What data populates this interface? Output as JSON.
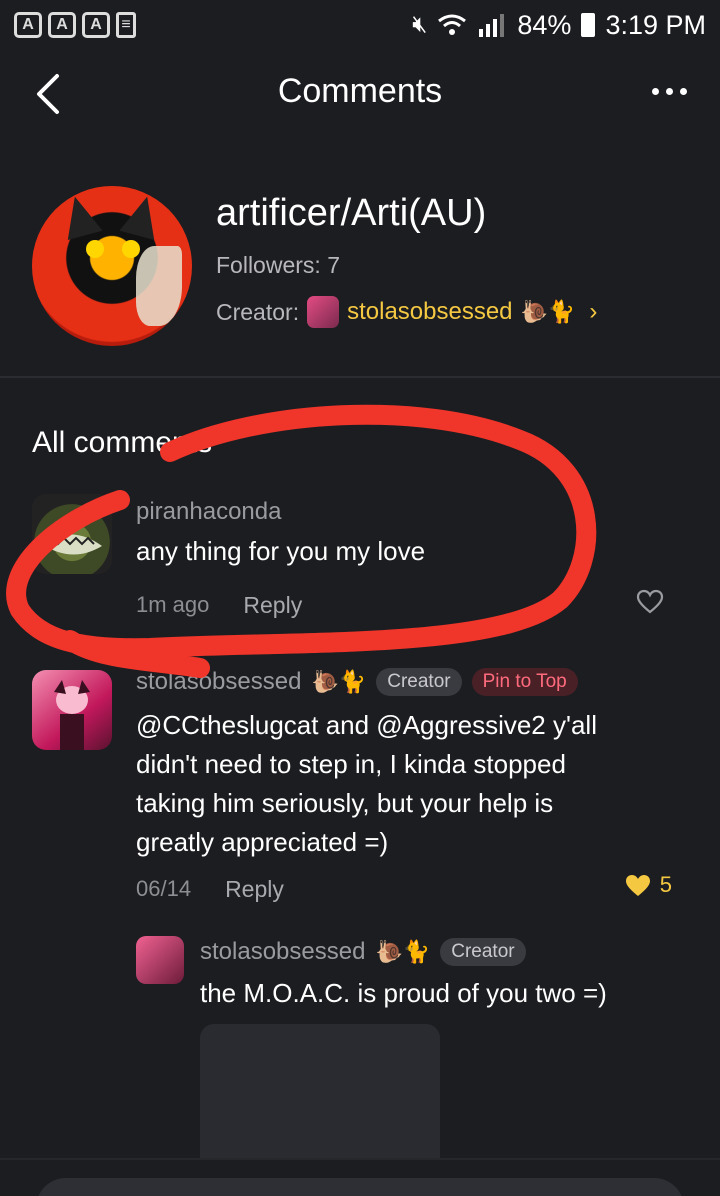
{
  "status_bar": {
    "time": "3:19 PM",
    "battery": "84%",
    "app_icons": [
      "A",
      "A",
      "A"
    ]
  },
  "header": {
    "title": "Comments"
  },
  "profile": {
    "name": "artificer/Arti(AU)",
    "followers": "Followers: 7",
    "creator_label": "Creator:",
    "creator_name": "stolasobsessed",
    "creator_emoji": "🐌🐈"
  },
  "section_title": "All comments",
  "comments": [
    {
      "user": "piranhaconda",
      "text": "any thing for you my love",
      "time": "1m ago",
      "reply": "Reply"
    },
    {
      "user": "stolasobsessed",
      "emoji": "🐌🐈",
      "badge": "Creator",
      "pin": "Pin to Top",
      "text": "@CCtheslugcat and @Aggressive2 y'all didn't need to step in, I kinda stopped taking him seriously, but your help is greatly appreciated =)",
      "time": "06/14",
      "reply": "Reply",
      "likes": "5"
    }
  ],
  "nested_reply": {
    "user": "stolasobsessed",
    "emoji": "🐌🐈",
    "badge": "Creator",
    "text": "the M.O.A.C. is proud of you two =)"
  },
  "colors": {
    "background": "#1c1d21",
    "accent_yellow": "#f5c842",
    "annotation_red": "#f0352a"
  }
}
